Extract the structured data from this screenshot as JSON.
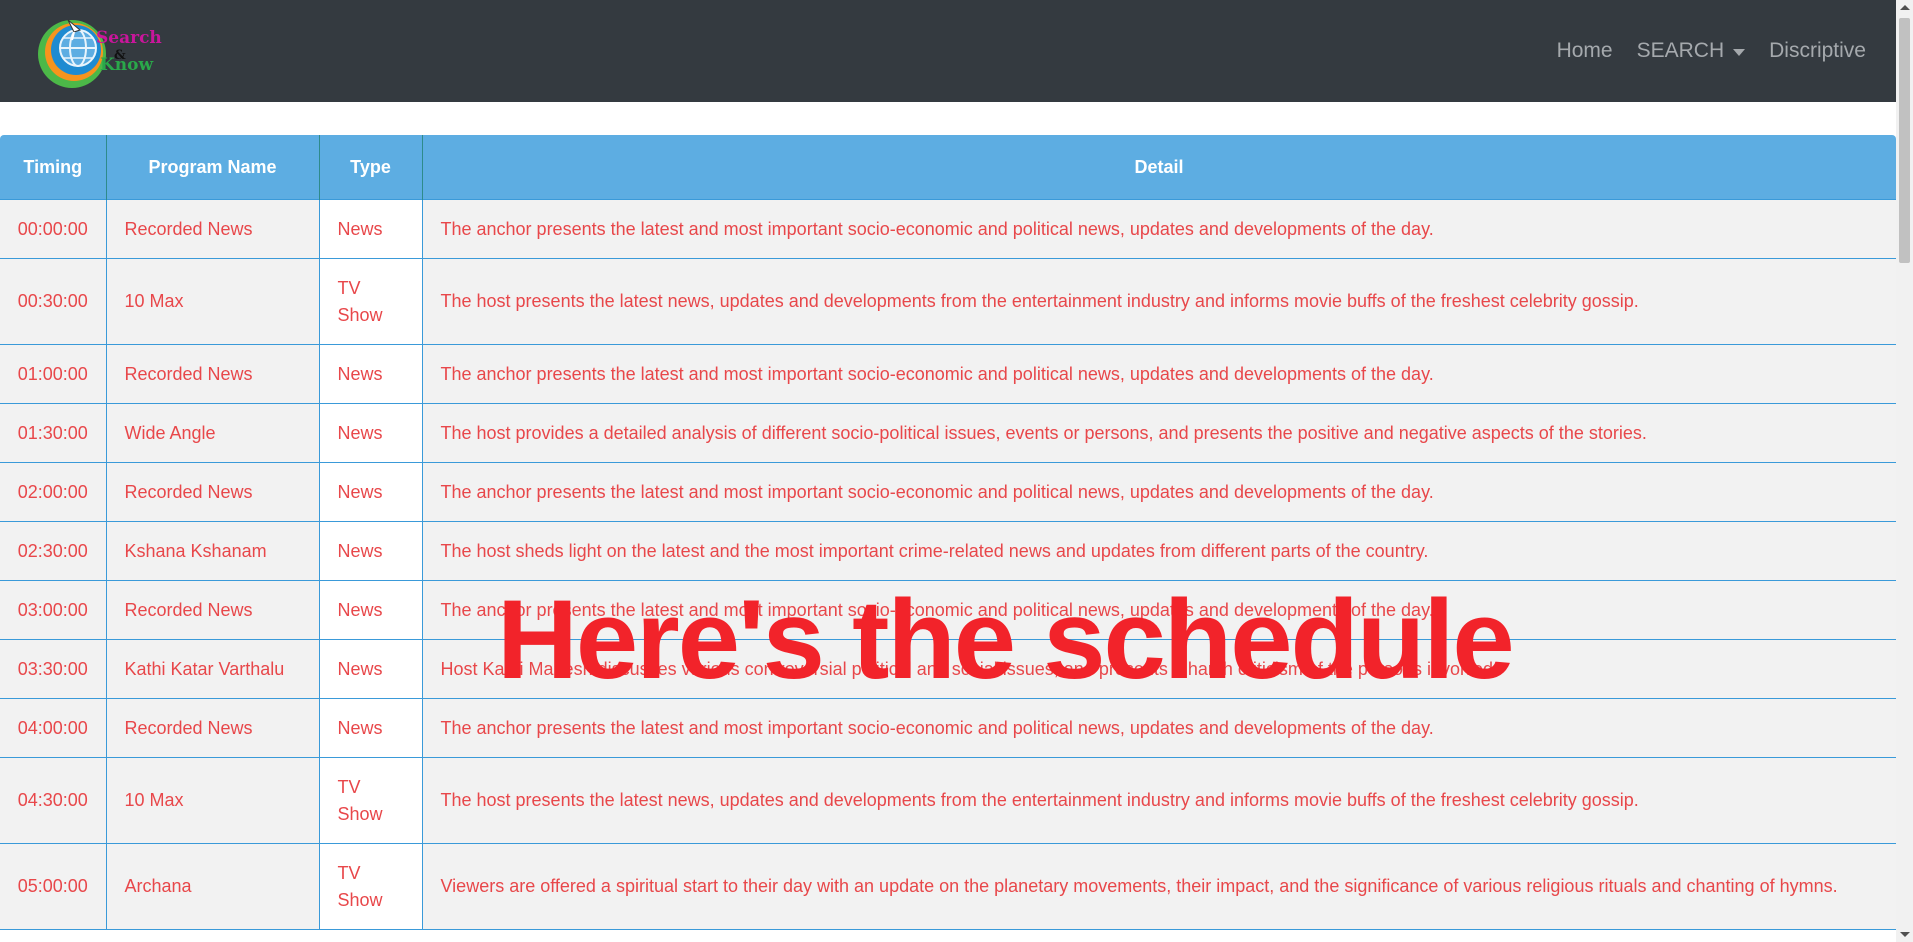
{
  "nav": {
    "logo_alt": "Search & Know",
    "logo_word1": "Search",
    "logo_amp": "&",
    "logo_word2": "Know",
    "links": [
      "Home",
      "SEARCH",
      "Discriptive"
    ]
  },
  "table": {
    "headers": [
      "Timing",
      "Program Name",
      "Type",
      "Detail"
    ],
    "rows": [
      {
        "timing": "00:00:00",
        "name": "Recorded News",
        "type": "News",
        "detail": "The anchor presents the latest and most important socio-economic and political news, updates and developments of the day."
      },
      {
        "timing": "00:30:00",
        "name": "10 Max",
        "type": "TV Show",
        "detail": "The host presents the latest news, updates and developments from the entertainment industry and informs movie buffs of the freshest celebrity gossip."
      },
      {
        "timing": "01:00:00",
        "name": "Recorded News",
        "type": "News",
        "detail": "The anchor presents the latest and most important socio-economic and political news, updates and developments of the day."
      },
      {
        "timing": "01:30:00",
        "name": "Wide Angle",
        "type": "News",
        "detail": "The host provides a detailed analysis of different socio-political issues, events or persons, and presents the positive and negative aspects of the stories."
      },
      {
        "timing": "02:00:00",
        "name": "Recorded News",
        "type": "News",
        "detail": "The anchor presents the latest and most important socio-economic and political news, updates and developments of the day."
      },
      {
        "timing": "02:30:00",
        "name": "Kshana Kshanam",
        "type": "News",
        "detail": "The host sheds light on the latest and the most important crime-related news and updates from different parts of the country."
      },
      {
        "timing": "03:00:00",
        "name": "Recorded News",
        "type": "News",
        "detail": "The anchor presents the latest and most important socio-economic and political news, updates and developments of the day."
      },
      {
        "timing": "03:30:00",
        "name": "Kathi Katar Varthalu",
        "type": "News",
        "detail": "Host Kathi Mahesh discusses various controversial political and social issues, and presents a harsh criticism of the persons involved."
      },
      {
        "timing": "04:00:00",
        "name": "Recorded News",
        "type": "News",
        "detail": "The anchor presents the latest and most important socio-economic and political news, updates and developments of the day."
      },
      {
        "timing": "04:30:00",
        "name": "10 Max",
        "type": "TV Show",
        "detail": "The host presents the latest news, updates and developments from the entertainment industry and informs movie buffs of the freshest celebrity gossip."
      },
      {
        "timing": "05:00:00",
        "name": "Archana",
        "type": "TV Show",
        "detail": "Viewers are offered a spiritual start to their day with an update on the planetary movements, their impact, and the significance of various religious rituals and chanting of hymns."
      }
    ]
  },
  "overlay": {
    "caption": "Here's the schedule"
  }
}
